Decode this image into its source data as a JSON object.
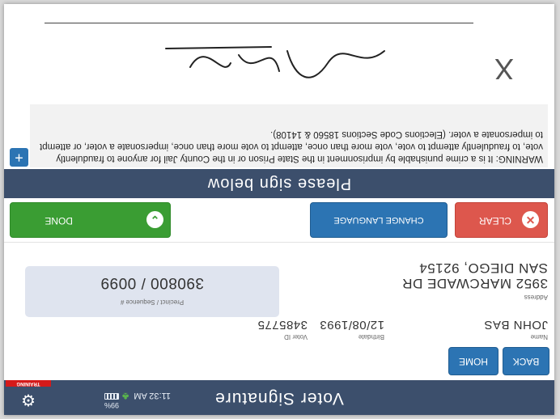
{
  "header": {
    "title": "Voter Signature",
    "training_label": "TRAINING",
    "battery": "99%",
    "time": "11:32 AM"
  },
  "nav": {
    "back_label": "BACK",
    "home_label": "HOME"
  },
  "voter": {
    "name_label": "Name",
    "name": "JOHN BAS",
    "birthdate_label": "Birthdate",
    "birthdate": "12/08/1993",
    "voter_id_label": "Voter ID",
    "voter_id": "3485775",
    "address_label": "Address",
    "address_line1": "3952 MARCWADE DR",
    "address_line2": "SAN DIEGO, 92154",
    "precinct_label": "Precinct / Sequence #",
    "precinct": "390800 / 0099"
  },
  "actions": {
    "clear_label": "CLEAR",
    "change_language_label": "CHANGE LANGUAGE",
    "done_label": "DONE"
  },
  "signature": {
    "prompt": "Please sign below",
    "warning": "WARNING: It is a crime punishable by imprisonment in the State Prison or in the County Jail for anyone to fraudulently vote, to fraudulently attempt to vote, vote more than once, attempt to vote more than once, impersonate a voter, or attempt to impersonate a voter. (Elections Code Sections 18560 & 14108).",
    "clear_mark": "X"
  },
  "colors": {
    "header_bg": "#3c4f6c",
    "clear": "#dd574d",
    "blue": "#2c74b3",
    "done": "#3a9d33",
    "training": "#d51a1a"
  }
}
